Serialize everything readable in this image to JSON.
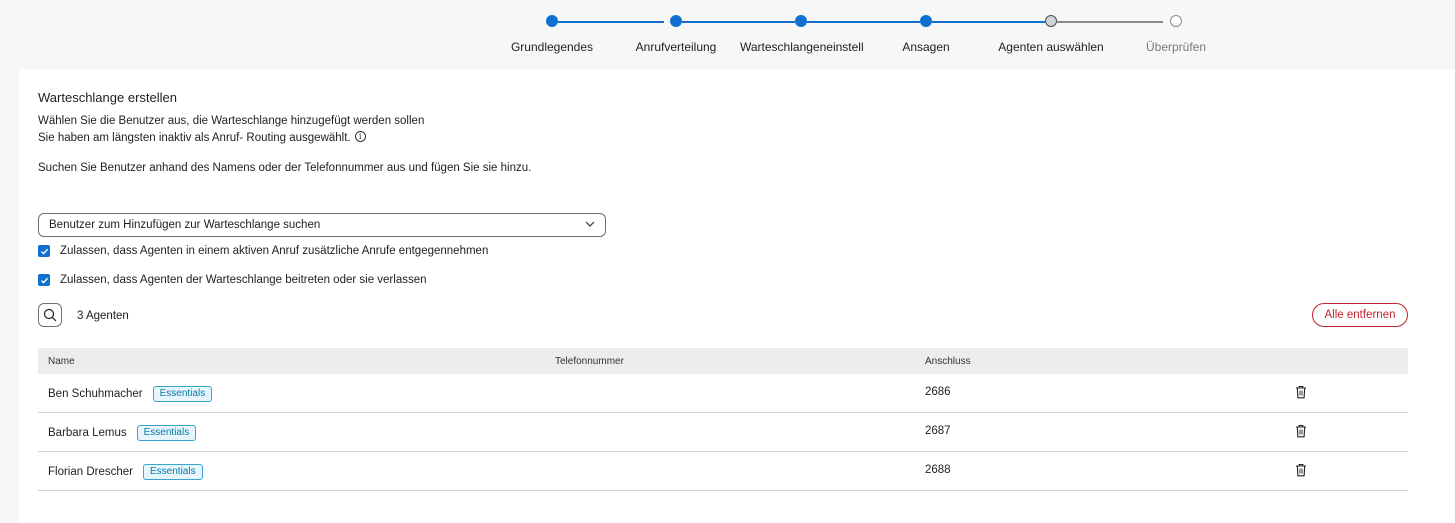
{
  "stepper": {
    "steps": [
      {
        "label": "Grundlegendes",
        "state": "done"
      },
      {
        "label": "Anrufverteilung",
        "state": "done"
      },
      {
        "label": "Warteschlangeneinstellungen",
        "state": "done"
      },
      {
        "label": "Ansagen",
        "state": "done"
      },
      {
        "label": "Agenten auswählen",
        "state": "current"
      },
      {
        "label": "Überprüfen",
        "state": "todo"
      }
    ]
  },
  "colors": {
    "accent": "#1170cf",
    "danger": "#c0242c",
    "badge_text": "#0a78a8",
    "badge_bg": "#e6f6fc"
  },
  "main": {
    "title": "Warteschlange erstellen",
    "desc_line1": "Wählen Sie die Benutzer aus, die Warteschlange hinzugefügt werden sollen",
    "desc_line2": "Sie haben am längsten inaktiv als Anruf- Routing ausgewählt.",
    "search_hint": "Suchen Sie Benutzer anhand des Namens oder der Telefonnummer aus und fügen Sie sie hinzu.",
    "user_search_placeholder": "Benutzer zum Hinzufügen zur Warteschlange suchen",
    "option1": {
      "label": "Zulassen, dass Agenten in einem aktiven Anruf zusätzliche Anrufe entgegennehmen",
      "checked": true
    },
    "option2": {
      "label": "Zulassen, dass Agenten der Warteschlange beitreten oder sie verlassen",
      "checked": true
    },
    "agent_count": "3 Agenten",
    "remove_all_label": "Alle entfernen"
  },
  "table": {
    "columns": {
      "name": "Name",
      "phone": "Telefonnummer",
      "extension": "Anschluss"
    },
    "rows": [
      {
        "name": "Ben Schuhmacher",
        "badge": "Essentials",
        "phone": "",
        "extension": "2686",
        "action_icon": "trash-icon"
      },
      {
        "name": "Barbara Lemus",
        "badge": "Essentials",
        "phone": "",
        "extension": "2687",
        "action_icon": "trash-icon"
      },
      {
        "name": "Florian Drescher",
        "badge": "Essentials",
        "phone": "",
        "extension": "2688",
        "action_icon": "trash-icon"
      }
    ]
  }
}
